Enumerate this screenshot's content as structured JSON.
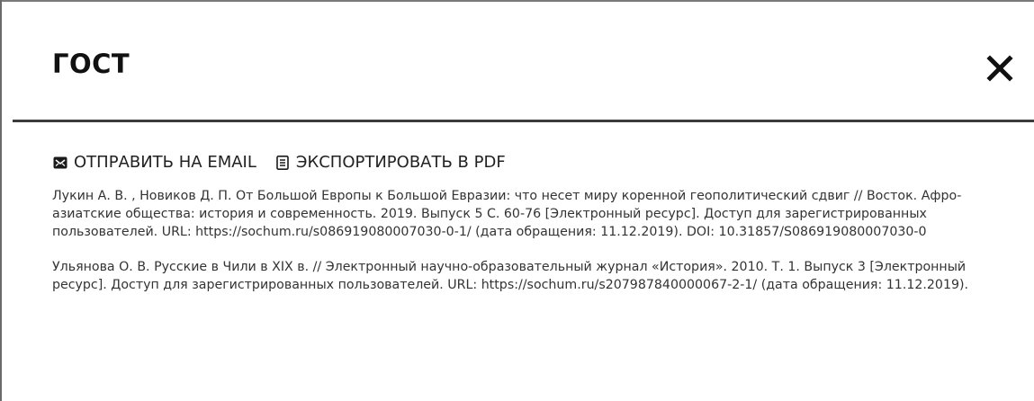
{
  "modal": {
    "title": "ГОСТ",
    "close_label": "✕"
  },
  "actions": {
    "email_label": "ОТПРАВИТЬ НА EMAIL",
    "pdf_label": "ЭКСПОРТИРОВАТЬ В PDF",
    "email_icon": "envelope-icon",
    "pdf_icon": "document-icon"
  },
  "references": [
    {
      "text": "Лукин А. В. , Новиков Д. П. От Большой Европы к Большой Евразии: что несет миру коренной геополитический сдвиг // Восток. Афро-азиатские общества: история и современность. 2019. Выпуск 5 С. 60-76 [Электронный ресурс]. Доступ для зарегистрированных пользователей. URL: https://sochum.ru/s086919080007030-0-1/ (дата обращения: 11.12.2019). DOI: 10.31857/S086919080007030-0"
    },
    {
      "text": "Ульянова О. В. Русские в Чили в XIX в. // Электронный научно-образовательный журнал «История». 2010. Т. 1. Выпуск 3 [Электронный ресурс]. Доступ для зарегистрированных пользователей. URL: https://sochum.ru/s207987840000067-2-1/ (дата обращения: 11.12.2019)."
    }
  ],
  "colors": {
    "text": "#333333",
    "title": "#111111",
    "rule": "#3b3b3b"
  }
}
